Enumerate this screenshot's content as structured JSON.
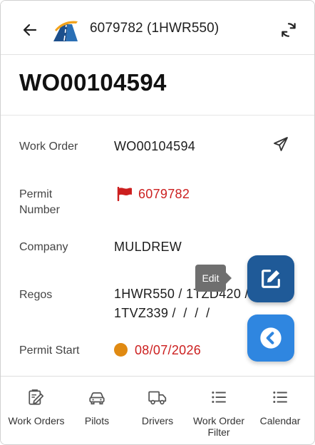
{
  "header": {
    "title": "6079782 (1HWR550)",
    "back_icon": "arrow-left-icon",
    "logo_icon": "road-logo-icon",
    "sync_icon": "sync-icon"
  },
  "page_title": "WO00104594",
  "fields": {
    "work_order": {
      "label": "Work Order",
      "value": "WO00104594"
    },
    "permit_number": {
      "label_line1": "Permit",
      "label_line2": "Number",
      "value": "6079782",
      "icon": "flag-icon"
    },
    "company": {
      "label": "Company",
      "value": "MULDREW"
    },
    "regos": {
      "label": "Regos",
      "value_line1": "1HWR550 / 1TZD420 /",
      "value_line2": "1TVZ339 /  /  /  /"
    },
    "permit_start": {
      "label": "Permit Start",
      "value": "08/07/2026",
      "icon": "status-dot-icon"
    }
  },
  "send_icon": "paper-plane-icon",
  "tooltip": {
    "text": "Edit"
  },
  "fab": {
    "edit_icon": "edit-icon",
    "back_icon": "chevron-left-circle-icon"
  },
  "colors": {
    "accent_dark": "#1f5a98",
    "accent_light": "#2f86e0",
    "warning_red": "#cc1f1f",
    "status_orange": "#e08a12"
  },
  "nav": {
    "items": [
      {
        "label": "Work Orders",
        "icon": "clipboard-edit-icon"
      },
      {
        "label": "Pilots",
        "icon": "car-icon"
      },
      {
        "label": "Drivers",
        "icon": "truck-icon"
      },
      {
        "label_line1": "Work Order",
        "label_line2": "Filter",
        "icon": "list-icon"
      },
      {
        "label": "Calendar",
        "icon": "list-icon"
      }
    ]
  }
}
